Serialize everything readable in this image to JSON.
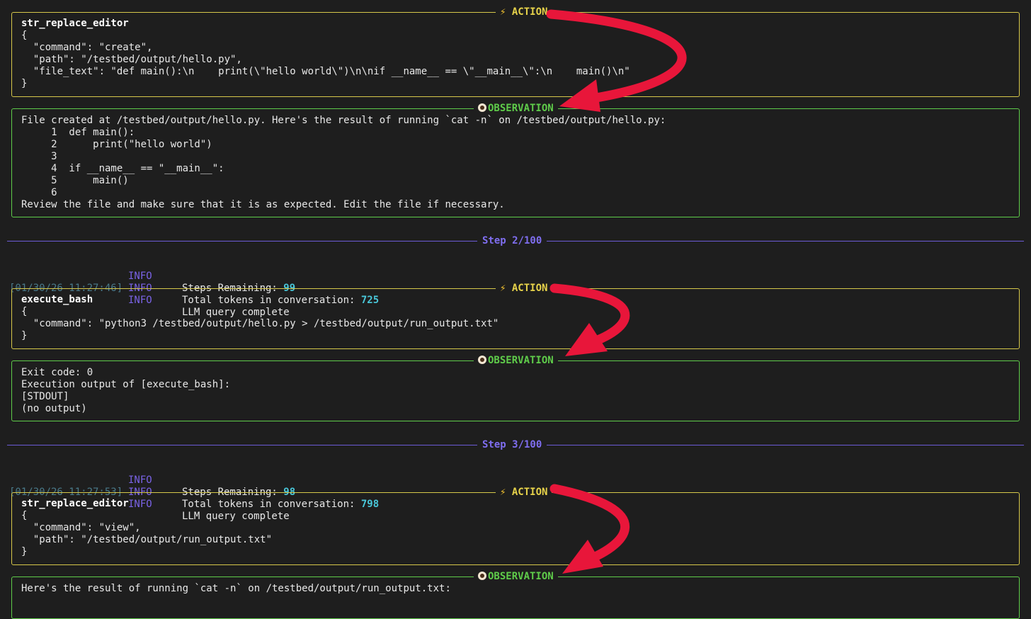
{
  "colors": {
    "background": "#1e1e1e",
    "action_border": "#d6c84a",
    "observation_border": "#5fcc4a",
    "step_rule": "#6b5bd6",
    "info_level": "#7a63e6",
    "number": "#49c6d8",
    "timestamp": "#4a7a8a",
    "arrow": "#e8163a"
  },
  "labels": {
    "action": "ACTION",
    "observation": "OBSERVATION"
  },
  "icons": {
    "action": "lightning-icon",
    "observation": "eye-icon",
    "annotation": "curved-arrow-icon"
  },
  "blocks": {
    "action1": {
      "tool": "str_replace_editor",
      "lines": [
        "{",
        "  \"command\": \"create\",",
        "  \"path\": \"/testbed/output/hello.py\",",
        "  \"file_text\": \"def main():\\n    print(\\\"hello world\\\")\\n\\nif __name__ == \\\"__main__\\\":\\n    main()\\n\"",
        "}"
      ]
    },
    "obs1": {
      "lines": [
        "File created at /testbed/output/hello.py. Here's the result of running `cat -n` on /testbed/output/hello.py:",
        "     1  def main():",
        "     2      print(\"hello world\")",
        "     3",
        "     4  if __name__ == \"__main__\":",
        "     5      main()",
        "     6",
        "Review the file and make sure that it is as expected. Edit the file if necessary."
      ]
    },
    "action2": {
      "tool": "execute_bash",
      "lines": [
        "{",
        "  \"command\": \"python3 /testbed/output/hello.py > /testbed/output/run_output.txt\"",
        "}"
      ]
    },
    "obs2": {
      "lines": [
        "Exit code: 0",
        "Execution output of [execute_bash]:",
        "[STDOUT]",
        "(no output)"
      ]
    },
    "action3": {
      "tool": "str_replace_editor",
      "lines": [
        "{",
        "  \"command\": \"view\",",
        "  \"path\": \"/testbed/output/run_output.txt\"",
        "}"
      ]
    },
    "obs3": {
      "lines": [
        "Here's the result of running `cat -n` on /testbed/output/run_output.txt:"
      ]
    }
  },
  "steps": [
    {
      "label": "Step 2/100",
      "logs": [
        {
          "ts": "",
          "level": "INFO",
          "text": "Steps Remaining: ",
          "num": "99"
        },
        {
          "ts": "",
          "level": "INFO",
          "text": "Total tokens in conversation: ",
          "num": "725"
        },
        {
          "ts": "[01/30/26 11:27:46]",
          "level": "INFO",
          "text": "LLM query complete",
          "num": ""
        }
      ]
    },
    {
      "label": "Step 3/100",
      "logs": [
        {
          "ts": "",
          "level": "INFO",
          "text": "Steps Remaining: ",
          "num": "98"
        },
        {
          "ts": "",
          "level": "INFO",
          "text": "Total tokens in conversation: ",
          "num": "798"
        },
        {
          "ts": "[01/30/26 11:27:53]",
          "level": "INFO",
          "text": "LLM query complete",
          "num": ""
        }
      ]
    }
  ]
}
